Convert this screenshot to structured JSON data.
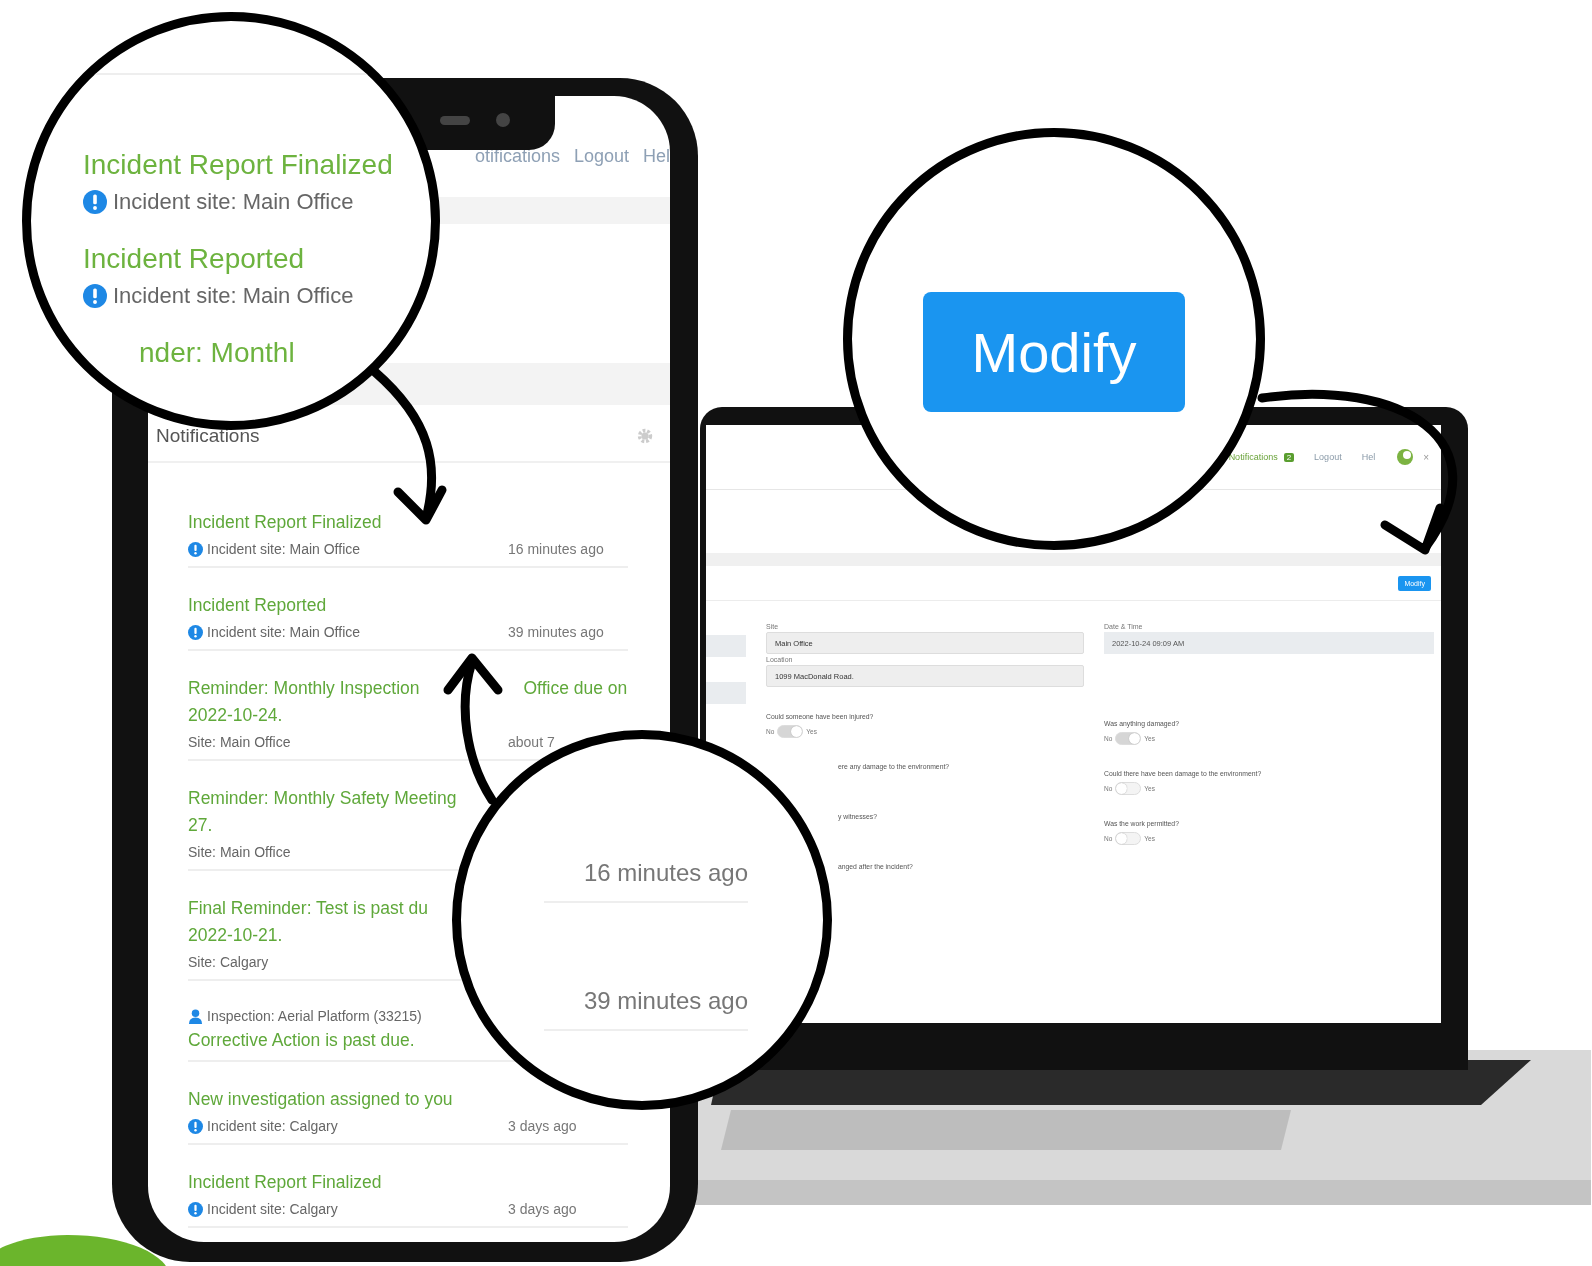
{
  "top_zoom": {
    "items": [
      {
        "title": "Incident Report Finalized",
        "detail": "Incident site: Main Office"
      },
      {
        "title": "Incident Reported",
        "detail": "Incident site: Main Office"
      }
    ],
    "cut_text": "nder: Monthl"
  },
  "modify_zoom": {
    "button": "Modify"
  },
  "time_zoom": {
    "times": [
      "16 minutes ago",
      "39 minutes ago"
    ]
  },
  "phone": {
    "nav": [
      "otifications",
      "Logout",
      "Hel"
    ],
    "header": "Notifications",
    "items": [
      {
        "kind": "incident",
        "title_lines": [
          [
            "Incident Report Finalized"
          ]
        ],
        "detail": "Incident site: Main Office",
        "time": "16 minutes ago"
      },
      {
        "kind": "incident",
        "title_lines": [
          [
            "Incident Reported"
          ]
        ],
        "detail": "Incident site: Main Office",
        "time": "39 minutes ago"
      },
      {
        "kind": "site",
        "title_lines": [
          [
            "Reminder: Monthly Inspection",
            "Office due on"
          ],
          [
            "2022-10-24."
          ]
        ],
        "detail": "Site: Main Office",
        "time": "about 7"
      },
      {
        "kind": "site",
        "title_lines": [
          [
            "Reminder: Monthly Safety Meeting"
          ],
          [
            "27."
          ]
        ],
        "detail": "Site: Main Office"
      },
      {
        "kind": "site",
        "title_lines": [
          [
            "Final Reminder: Test is past du"
          ],
          [
            "2022-10-21."
          ]
        ],
        "detail": "Site: Calgary"
      },
      {
        "kind": "inspection",
        "title_lines": [
          [
            "Corrective Action is past due."
          ]
        ],
        "detail": "Inspection: Aerial Platform (33215)"
      },
      {
        "kind": "incident",
        "title_lines": [
          [
            "New investigation assigned to you"
          ]
        ],
        "detail": "Incident site: Calgary",
        "time": "3 days ago"
      },
      {
        "kind": "incident",
        "title_lines": [
          [
            "Incident Report Finalized"
          ]
        ],
        "detail": "Incident site: Calgary",
        "time": "3 days ago"
      }
    ]
  },
  "laptop": {
    "nav": {
      "notifications": "Notifications",
      "badge": "2",
      "logout": "Logout",
      "help": "Hel",
      "close": "×"
    },
    "modify_button": "Modify",
    "site": {
      "label": "Site",
      "value": "Main Office"
    },
    "location": {
      "label": "Location",
      "value": "1099 MacDonald Road."
    },
    "date_time": {
      "label": "Date & Time",
      "value": "2022-10-24 09:09 AM"
    },
    "questions_left": [
      {
        "kind": "full",
        "label": "Could someone have been injured?",
        "no": "No",
        "yes": "Yes",
        "on": true
      },
      {
        "kind": "clipped",
        "label": "ere any damage to the environment?"
      },
      {
        "kind": "clipped",
        "label": "y witnesses?"
      },
      {
        "kind": "clipped",
        "label": "anged after the incident?"
      }
    ],
    "questions_right": [
      {
        "label": "Was anything damaged?",
        "no": "No",
        "yes": "Yes",
        "on": true
      },
      {
        "label": "Could there have been damage to the environment?",
        "no": "No",
        "yes": "Yes",
        "on": false
      },
      {
        "label": "Was the work permitted?",
        "no": "No",
        "yes": "Yes",
        "on": false
      }
    ]
  }
}
